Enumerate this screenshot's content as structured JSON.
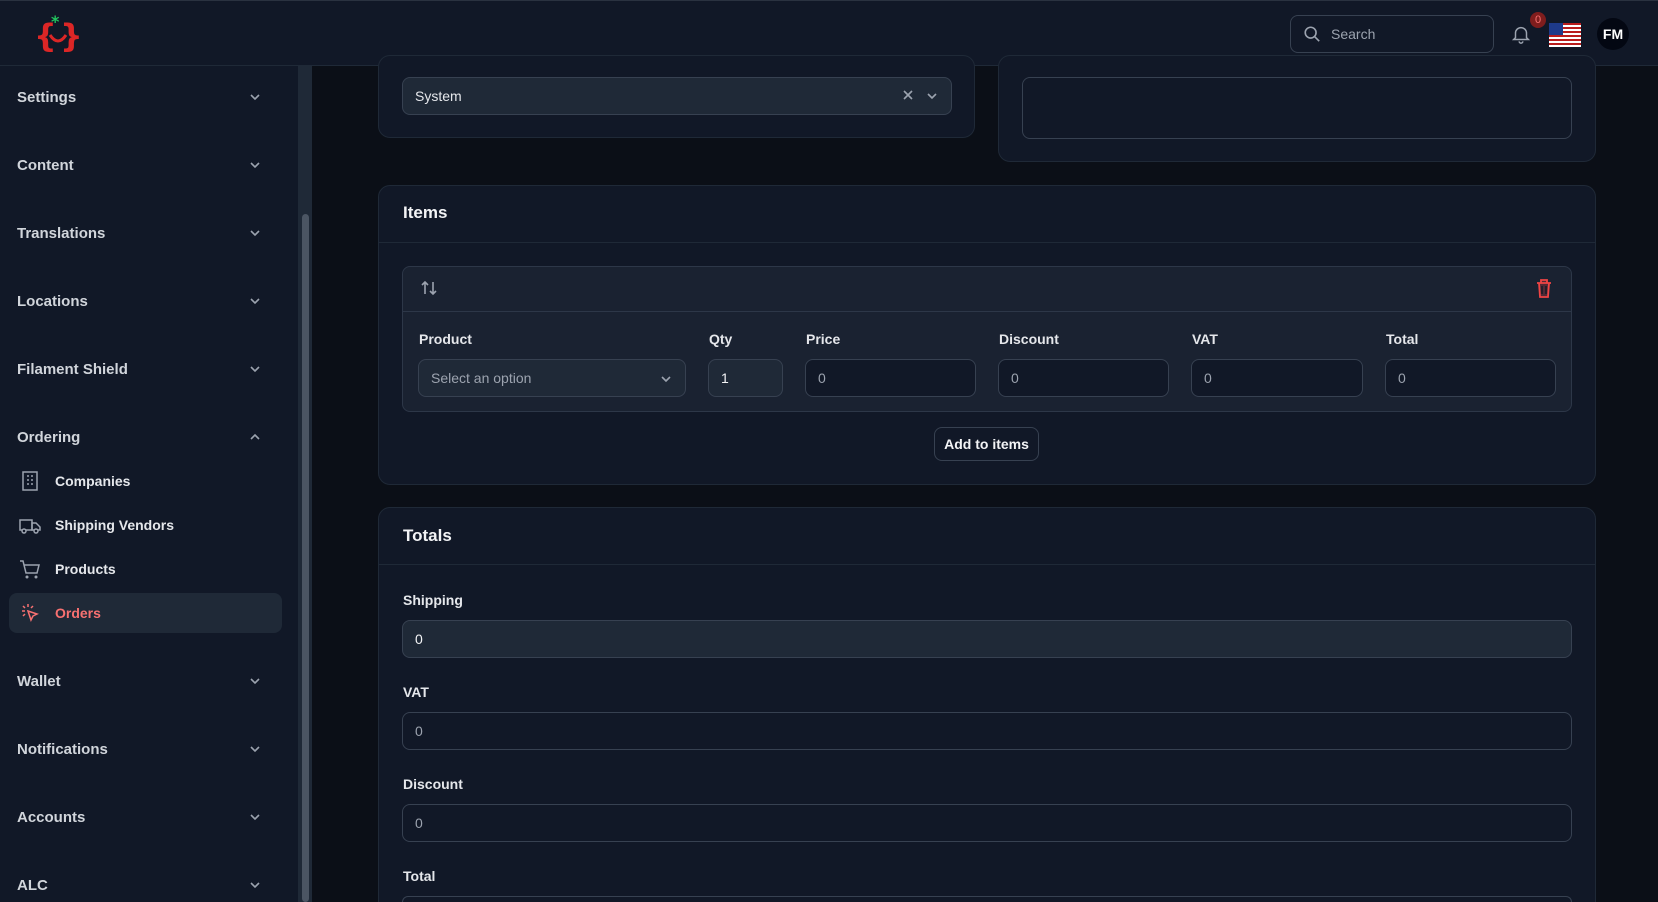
{
  "topbar": {
    "search_placeholder": "Search",
    "notification_count": "0",
    "avatar_initials": "FM"
  },
  "sidebar": {
    "groups": [
      {
        "label": "Settings"
      },
      {
        "label": "Content"
      },
      {
        "label": "Translations"
      },
      {
        "label": "Locations"
      },
      {
        "label": "Filament Shield"
      },
      {
        "label": "Ordering"
      },
      {
        "label": "Wallet"
      },
      {
        "label": "Notifications"
      },
      {
        "label": "Accounts"
      },
      {
        "label": "ALC"
      }
    ],
    "ordering_items": [
      {
        "label": "Companies",
        "icon": "building-icon"
      },
      {
        "label": "Shipping Vendors",
        "icon": "truck-icon"
      },
      {
        "label": "Products",
        "icon": "cart-icon"
      },
      {
        "label": "Orders",
        "icon": "cursor-click-icon",
        "active": true
      }
    ]
  },
  "main": {
    "source_select_value": "System",
    "items": {
      "title": "Items",
      "columns": {
        "product": "Product",
        "qty": "Qty",
        "price": "Price",
        "discount": "Discount",
        "vat": "VAT",
        "total": "Total"
      },
      "row": {
        "product_placeholder": "Select an option",
        "qty": "1",
        "price": "0",
        "discount": "0",
        "vat": "0",
        "total": "0"
      },
      "add_button": "Add to items"
    },
    "totals": {
      "title": "Totals",
      "shipping_label": "Shipping",
      "shipping_value": "0",
      "vat_label": "VAT",
      "vat_value": "0",
      "discount_label": "Discount",
      "discount_value": "0",
      "total_label": "Total"
    }
  },
  "colors": {
    "accent": "#f87171",
    "background": "#0b0f17",
    "panel": "#111827"
  }
}
